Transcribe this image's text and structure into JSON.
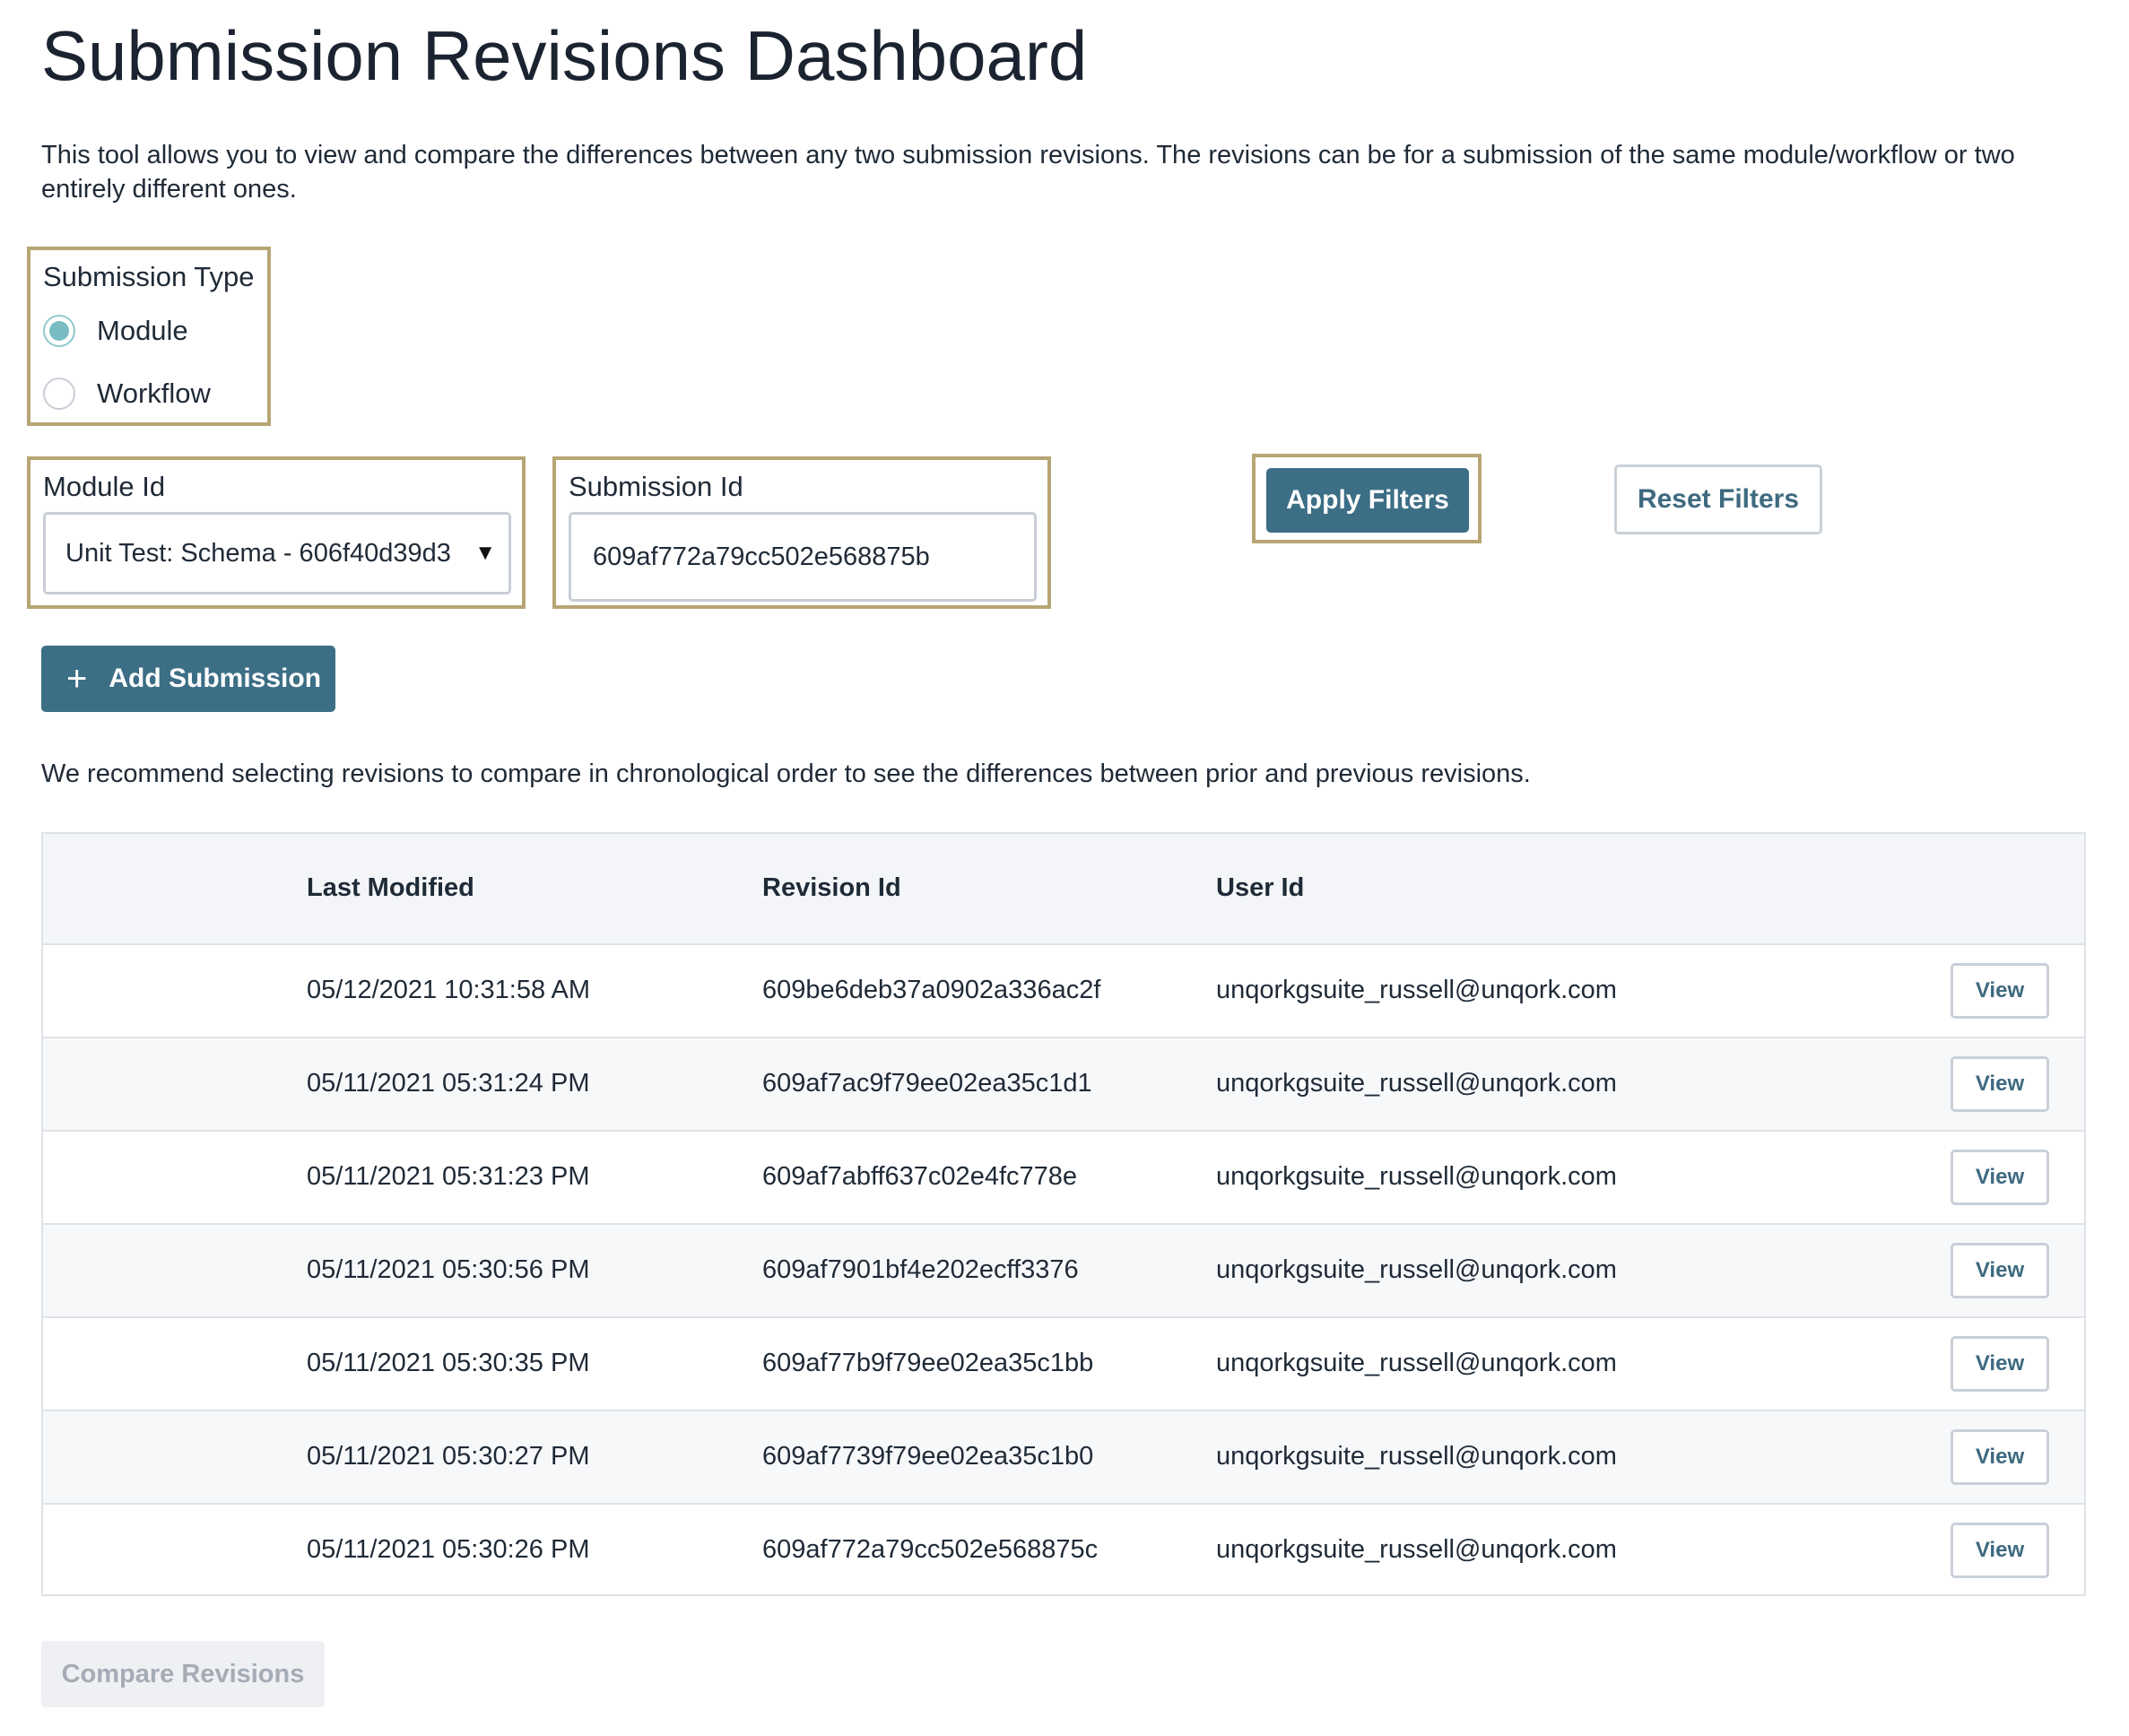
{
  "page": {
    "title": "Submission Revisions Dashboard",
    "intro": "This tool allows you to view and compare the differences between any two submission revisions. The revisions can be for a submission of the same module/workflow or two entirely different ones."
  },
  "filters": {
    "submission_type": {
      "legend": "Submission Type",
      "options": [
        {
          "label": "Module",
          "checked": true
        },
        {
          "label": "Workflow",
          "checked": false
        }
      ]
    },
    "module_id": {
      "label": "Module Id",
      "selected": "Unit Test: Schema - 606f40d39d3"
    },
    "submission_id": {
      "label": "Submission Id",
      "value": "609af772a79cc502e568875b"
    },
    "apply_label": "Apply Filters",
    "reset_label": "Reset Filters"
  },
  "add_submission": {
    "icon": "plus-icon",
    "label": "Add Submission"
  },
  "recommendation": "We recommend selecting revisions to compare in chronological order to see the differences between prior and previous revisions.",
  "table": {
    "headers": [
      "Last Modified",
      "Revision Id",
      "User Id"
    ],
    "view_label": "View",
    "rows": [
      {
        "last_modified": "05/12/2021 10:31:58 AM",
        "revision_id": "609be6deb37a0902a336ac2f",
        "user_id": "unqorkgsuite_russell@unqork.com"
      },
      {
        "last_modified": "05/11/2021 05:31:24 PM",
        "revision_id": "609af7ac9f79ee02ea35c1d1",
        "user_id": "unqorkgsuite_russell@unqork.com"
      },
      {
        "last_modified": "05/11/2021 05:31:23 PM",
        "revision_id": "609af7abff637c02e4fc778e",
        "user_id": "unqorkgsuite_russell@unqork.com"
      },
      {
        "last_modified": "05/11/2021 05:30:56 PM",
        "revision_id": "609af7901bf4e202ecff3376",
        "user_id": "unqorkgsuite_russell@unqork.com"
      },
      {
        "last_modified": "05/11/2021 05:30:35 PM",
        "revision_id": "609af77b9f79ee02ea35c1bb",
        "user_id": "unqorkgsuite_russell@unqork.com"
      },
      {
        "last_modified": "05/11/2021 05:30:27 PM",
        "revision_id": "609af7739f79ee02ea35c1b0",
        "user_id": "unqorkgsuite_russell@unqork.com"
      },
      {
        "last_modified": "05/11/2021 05:30:26 PM",
        "revision_id": "609af772a79cc502e568875c",
        "user_id": "unqorkgsuite_russell@unqork.com"
      }
    ]
  },
  "compare_label": "Compare Revisions",
  "colors": {
    "primary_button": "#3c6e86",
    "highlight_border": "#b7a574",
    "radio_checked": "#78bcc2"
  }
}
